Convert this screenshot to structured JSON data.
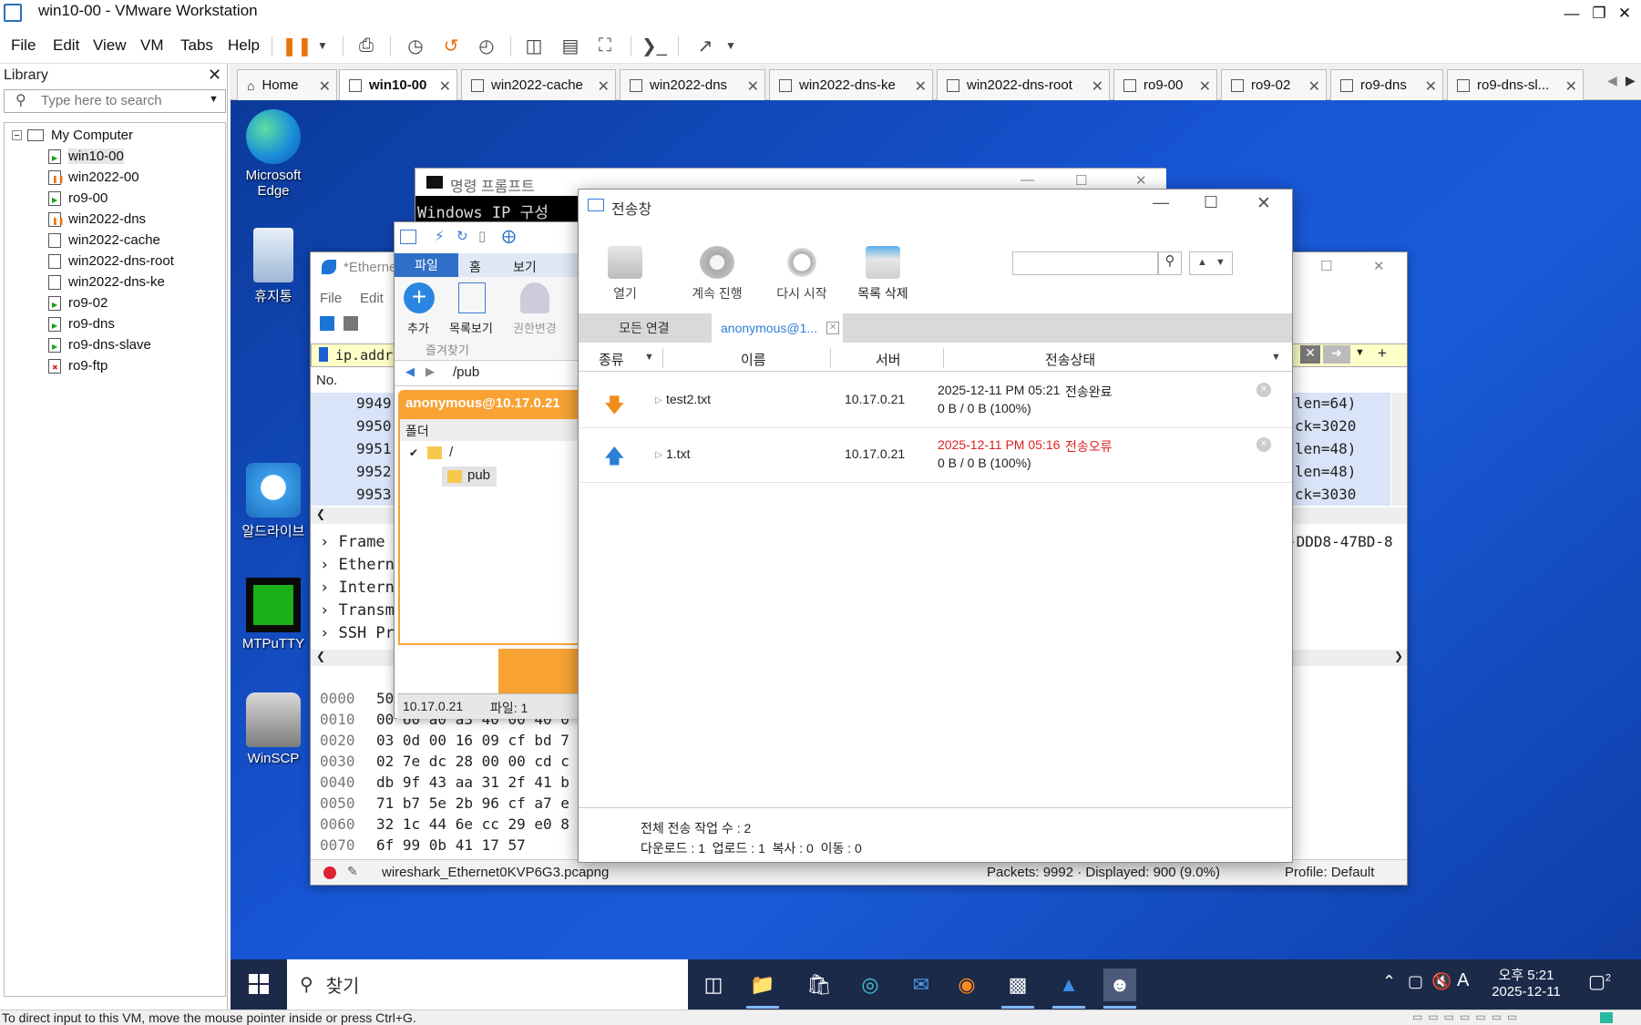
{
  "window": {
    "title": "win10-00 - VMware Workstation"
  },
  "menu": [
    "File",
    "Edit",
    "View",
    "VM",
    "Tabs",
    "Help"
  ],
  "library": {
    "title": "Library",
    "search_placeholder": "Type here to search",
    "root": "My Computer",
    "vms": [
      "win10-00",
      "win2022-00",
      "ro9-00",
      "win2022-dns",
      "win2022-cache",
      "win2022-dns-root",
      "win2022-dns-ke",
      "ro9-02",
      "ro9-dns",
      "ro9-dns-slave",
      "ro9-ftp"
    ]
  },
  "tabs": [
    "Home",
    "win10-00",
    "win2022-cache",
    "win2022-dns",
    "win2022-dns-ke",
    "win2022-dns-root",
    "ro9-00",
    "ro9-02",
    "ro9-dns",
    "ro9-dns-sl..."
  ],
  "status_bar": "To direct input to this VM, move the mouse pointer inside or press Ctrl+G.",
  "desktop_icons": [
    "Microsoft Edge",
    "휴지통",
    "알드라이브",
    "MTPuTTY",
    "WinSCP"
  ],
  "taskbar": {
    "search": "찾기",
    "time": "오후 5:21",
    "date": "2025-12-11",
    "notif_count": "2"
  },
  "cmd": {
    "title": "명령 프롬프트",
    "line": "Windows IP 구성"
  },
  "wireshark": {
    "title": "*Etherne",
    "menu": [
      "File",
      "Edit"
    ],
    "filter": "ip.addr =",
    "col_no": "No.",
    "rows": [
      "9949",
      "9950",
      "9951",
      "9952",
      "9953"
    ],
    "rows_right": [
      "len=64)",
      "ck=3020",
      "len=48)",
      "len=48)",
      "ck=3030"
    ],
    "detail": [
      "Frame",
      "Ethern",
      "Intern",
      "Transm",
      "SSH Pr"
    ],
    "detail_right": "-DDD8-47BD-8",
    "hex_offsets": [
      "0000",
      "0010",
      "0020",
      "0030",
      "0040",
      "0050",
      "0060",
      "0070"
    ],
    "hex_bytes": [
      "50",
      "00 60 a0 a3 40 00 40 0",
      "03 0d 00 16 09 cf bd 7",
      "02 7e dc 28 00 00 cd c",
      "db 9f 43 aa 31 2f 41 b",
      "71 b7 5e 2b 96 cf a7 e",
      "32 1c 44 6e cc 29 e0 8",
      "6f 99 0b 41 17 57"
    ],
    "status_file": "wireshark_Ethernet0KVP6G3.pcapng",
    "status_packets": "Packets: 9992 · Displayed: 900 (9.0%)",
    "status_profile": "Profile: Default"
  },
  "alftp": {
    "tabs": [
      "파일",
      "홈",
      "보기"
    ],
    "add": "추가",
    "list_view": "목록보기",
    "perm": "권한변경",
    "favorites": "즐겨찾기",
    "path": "/pub",
    "session": "anonymous@10.17.0.21",
    "folder_header": "폴더",
    "tree_root": "/",
    "tree_child": "pub",
    "status_ip": "10.17.0.21",
    "status_files": "파일: 1"
  },
  "transfer": {
    "title": "전송창",
    "toolbar": [
      "열기",
      "계속 진행",
      "다시 시작",
      "목록 삭제"
    ],
    "tabs": [
      "모든 연결",
      "anonymous@1..."
    ],
    "columns": [
      "종류",
      "이름",
      "서버",
      "전송상태"
    ],
    "rows": [
      {
        "name": "test2.txt",
        "server": "10.17.0.21",
        "status_time": "2025-12-11 PM 05:21",
        "status": "전송완료",
        "bytes": "0 B / 0 B (100%)",
        "direction": "download"
      },
      {
        "name": "1.txt",
        "server": "10.17.0.21",
        "status_time": "2025-12-11 PM 05:16",
        "status": "전송오류",
        "bytes": "0 B / 0 B (100%)",
        "direction": "upload"
      }
    ],
    "footer_total": "전체 전송 작업 수 : 2",
    "footer_detail": "다운로드 : 1  업로드 : 1  복사 : 0  이동 : 0"
  },
  "colors": {
    "desktop": "#1856d6",
    "accent": "#2b7fd4",
    "error": "#e02020",
    "wireshark_filter": "#ffffc8",
    "alftp_orange": "#f7a233"
  }
}
